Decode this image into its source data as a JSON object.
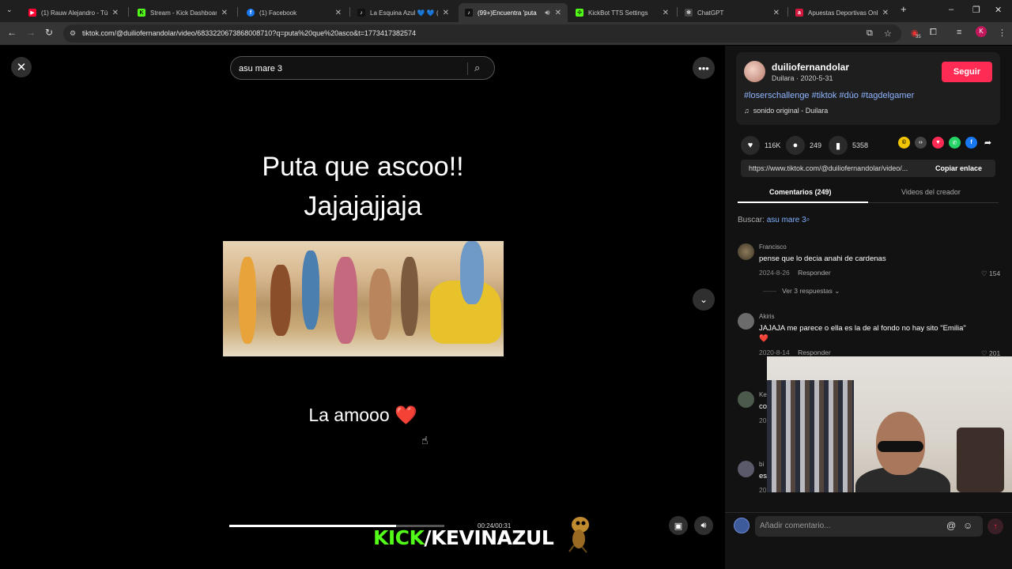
{
  "browser": {
    "tabs": [
      {
        "label": "(1) Rauw Alejandro - Tú c",
        "icon": "youtube-icon",
        "color": "#ff0033",
        "glyph": "▶",
        "active": false
      },
      {
        "label": "Stream - Kick Dashboard",
        "icon": "kick-icon",
        "color": "#53fc18",
        "glyph": "K",
        "active": false
      },
      {
        "label": "(1) Facebook",
        "icon": "facebook-icon",
        "color": "#1877f2",
        "glyph": "f",
        "active": false
      },
      {
        "label": "La Esquina Azul 💙 💙 (@",
        "icon": "tiktok-icon",
        "color": "#111111",
        "glyph": "♪",
        "active": false
      },
      {
        "label": "(99+)Encuentra 'puta",
        "icon": "tiktok-icon",
        "color": "#111111",
        "glyph": "♪",
        "active": true
      },
      {
        "label": "KickBot TTS Settings",
        "icon": "kickbot-icon",
        "color": "#53fc18",
        "glyph": "✣",
        "active": false
      },
      {
        "label": "ChatGPT",
        "icon": "chatgpt-icon",
        "color": "#444444",
        "glyph": "✻",
        "active": false
      },
      {
        "label": "Apuestas Deportivas Onl",
        "icon": "betting-icon",
        "color": "#d4173d",
        "glyph": "a",
        "active": false
      }
    ],
    "url": "tiktok.com/@duiliofernandolar/video/6833220673868008710?q=puta%20que%20asco&t=1773417382574",
    "extension_badge": "35",
    "profile_initial": "K"
  },
  "video": {
    "search_query": "asu mare 3",
    "caption_top_line1": "Puta que ascoo!!",
    "caption_top_line2": "Jajajajjaja",
    "caption_bottom": "La amooo ❤️",
    "timecode": "00:24/00:31",
    "progress_fraction": 0.774
  },
  "post": {
    "username": "duiliofernandolar",
    "subline": "Duilara · 2020-5-31",
    "follow_label": "Seguir",
    "hashtags": "#loserschallenge #tiktok #dúo #tagdelgamer",
    "sound": "sonido original - Duilara",
    "likes": "116K",
    "comments": "249",
    "saves": "5358",
    "share_link": "https://www.tiktok.com/@duiliofernandolar/video/...",
    "copy_label": "Copiar enlace"
  },
  "panel_tabs": {
    "comments": "Comentarios (249)",
    "creator_videos": "Videos del creador"
  },
  "search_hint": {
    "prefix": "Buscar:",
    "term": "asu mare 3"
  },
  "comments": [
    {
      "name": "Francisco",
      "text": "pense que lo decia anahi de cardenas",
      "date": "2024-8-26",
      "reply": "Responder",
      "likes": "154"
    },
    {
      "name": "Akiris",
      "text": "JAJAJA me parece o ella es la de al fondo no hay sito \"Emilia\" ❤️",
      "date": "2020-8-14",
      "reply": "Responder",
      "likes": "201"
    },
    {
      "name": "Ke",
      "text": "co",
      "date": "20",
      "reply": "",
      "likes": ""
    },
    {
      "name": "bi",
      "text": "es",
      "date": "20",
      "reply": "",
      "likes": ""
    }
  ],
  "view_replies": "Ver 3 respuestas",
  "comment_input": {
    "placeholder": "Añadir comentario..."
  },
  "branding": {
    "kick": "KICK",
    "channel": "/KEVINAZUL"
  }
}
